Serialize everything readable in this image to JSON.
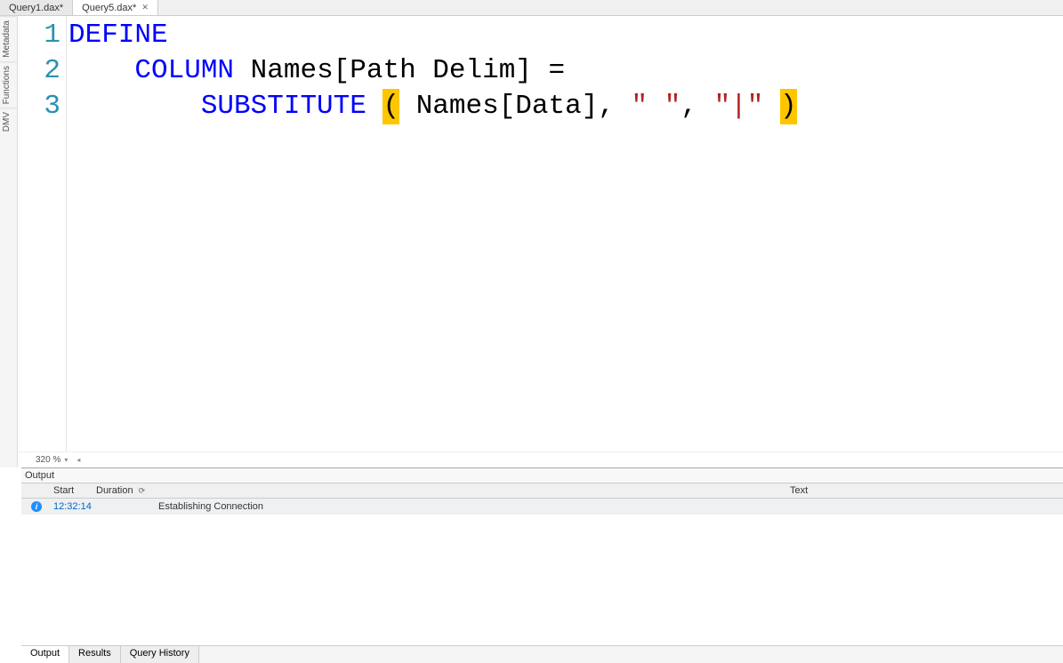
{
  "tabs": [
    {
      "label": "Query1.dax*",
      "active": false
    },
    {
      "label": "Query5.dax*",
      "active": true
    }
  ],
  "sideTabs": [
    "Metadata",
    "Functions",
    "DMV"
  ],
  "editor": {
    "zoom": "320 %",
    "lineNumbers": [
      "1",
      "2",
      "3"
    ],
    "tokens": {
      "define": "DEFINE",
      "column": "COLUMN",
      "tableRef1": "Names[Path Delim]",
      "eq": "=",
      "substitute": "SUBSTITUTE",
      "lparen": "(",
      "tableRef2": "Names[Data]",
      "comma1": ",",
      "str1": "\" \"",
      "comma2": ",",
      "str2": "\"|\"",
      "rparen": ")"
    }
  },
  "output": {
    "title": "Output",
    "columns": {
      "start": "Start",
      "duration": "Duration",
      "text": "Text"
    },
    "rows": [
      {
        "start": "12:32:14",
        "duration": "",
        "text": "Establishing Connection"
      }
    ]
  },
  "bottomTabs": [
    {
      "label": "Output",
      "active": true
    },
    {
      "label": "Results",
      "active": false
    },
    {
      "label": "Query History",
      "active": false
    }
  ]
}
